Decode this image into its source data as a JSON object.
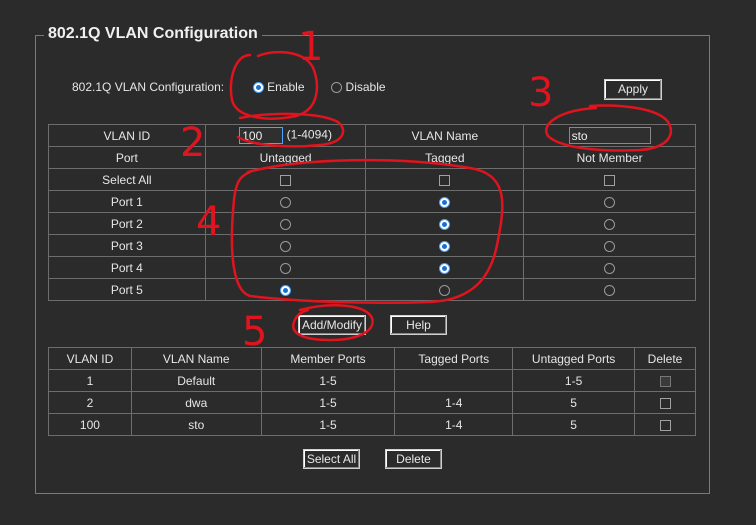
{
  "title": "802.1Q VLAN Configuration",
  "config": {
    "label": "802.1Q VLAN Configuration:",
    "enable_label": "Enable",
    "disable_label": "Disable",
    "apply_label": "Apply"
  },
  "vlan_form": {
    "vlan_id_label": "VLAN ID",
    "vlan_id_value": "100",
    "vlan_id_range": "(1-4094)",
    "vlan_name_label": "VLAN Name",
    "vlan_name_value": "sto",
    "col_port": "Port",
    "col_untagged": "Untagged",
    "col_tagged": "Tagged",
    "col_not_member": "Not Member",
    "select_all_label": "Select All",
    "ports": [
      {
        "name": "Port 1",
        "mode": "tagged"
      },
      {
        "name": "Port 2",
        "mode": "tagged"
      },
      {
        "name": "Port 3",
        "mode": "tagged"
      },
      {
        "name": "Port 4",
        "mode": "tagged"
      },
      {
        "name": "Port 5",
        "mode": "untagged"
      }
    ],
    "add_modify_label": "Add/Modify",
    "help_label": "Help"
  },
  "vlan_table": {
    "headers": [
      "VLAN ID",
      "VLAN Name",
      "Member Ports",
      "Tagged Ports",
      "Untagged Ports",
      "Delete"
    ],
    "rows": [
      {
        "id": "1",
        "name": "Default",
        "member": "1-5",
        "tagged": "",
        "untagged": "1-5"
      },
      {
        "id": "2",
        "name": "dwa",
        "member": "1-5",
        "tagged": "1-4",
        "untagged": "5"
      },
      {
        "id": "100",
        "name": "sto",
        "member": "1-5",
        "tagged": "1-4",
        "untagged": "5"
      }
    ],
    "select_all_label": "Select All",
    "delete_label": "Delete"
  },
  "annotations": {
    "color": "#e0141e",
    "n1": "1",
    "n2": "2",
    "n3": "3",
    "n4": "4",
    "n5": "5"
  }
}
